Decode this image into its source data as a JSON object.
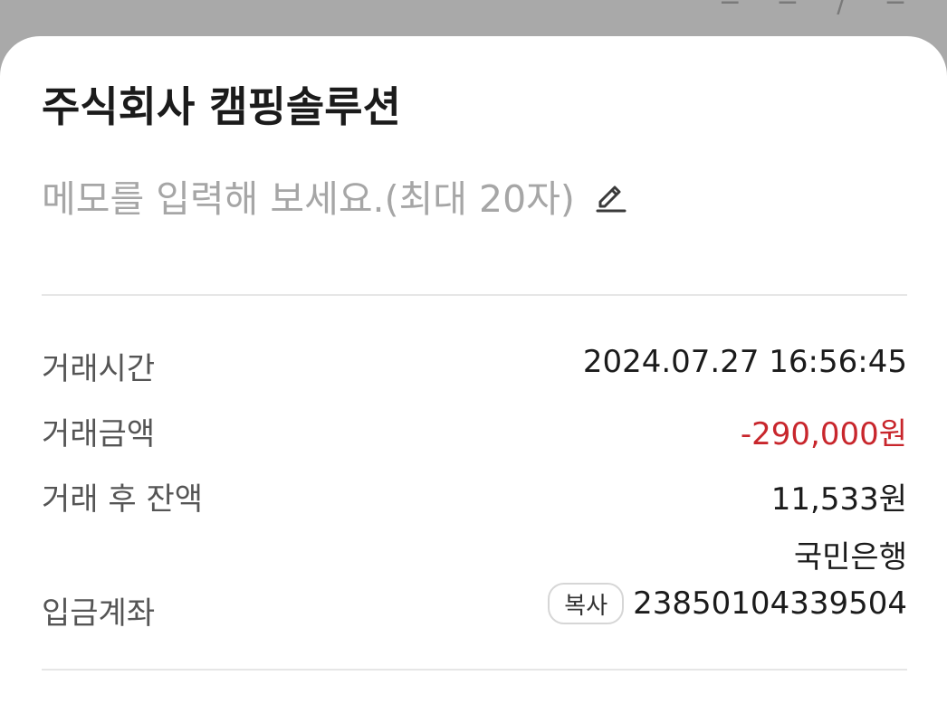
{
  "backdrop": {
    "marks": "─ ─ / ─"
  },
  "header": {
    "merchant_name": "주식회사 캠핑솔루션"
  },
  "memo": {
    "placeholder": "메모를 입력해 보세요.(최대 20자)",
    "icon": "pencil-edit-icon"
  },
  "details": {
    "time": {
      "label": "거래시간",
      "value": "2024.07.27 16:56:45"
    },
    "amount": {
      "label": "거래금액",
      "value": "-290,000원",
      "color": "#c8262c"
    },
    "balance": {
      "label": "거래 후 잔액",
      "value": "11,533원"
    },
    "account": {
      "label": "입금계좌",
      "bank": "국민은행",
      "number": "23850104339504",
      "copy_label": "복사"
    }
  }
}
